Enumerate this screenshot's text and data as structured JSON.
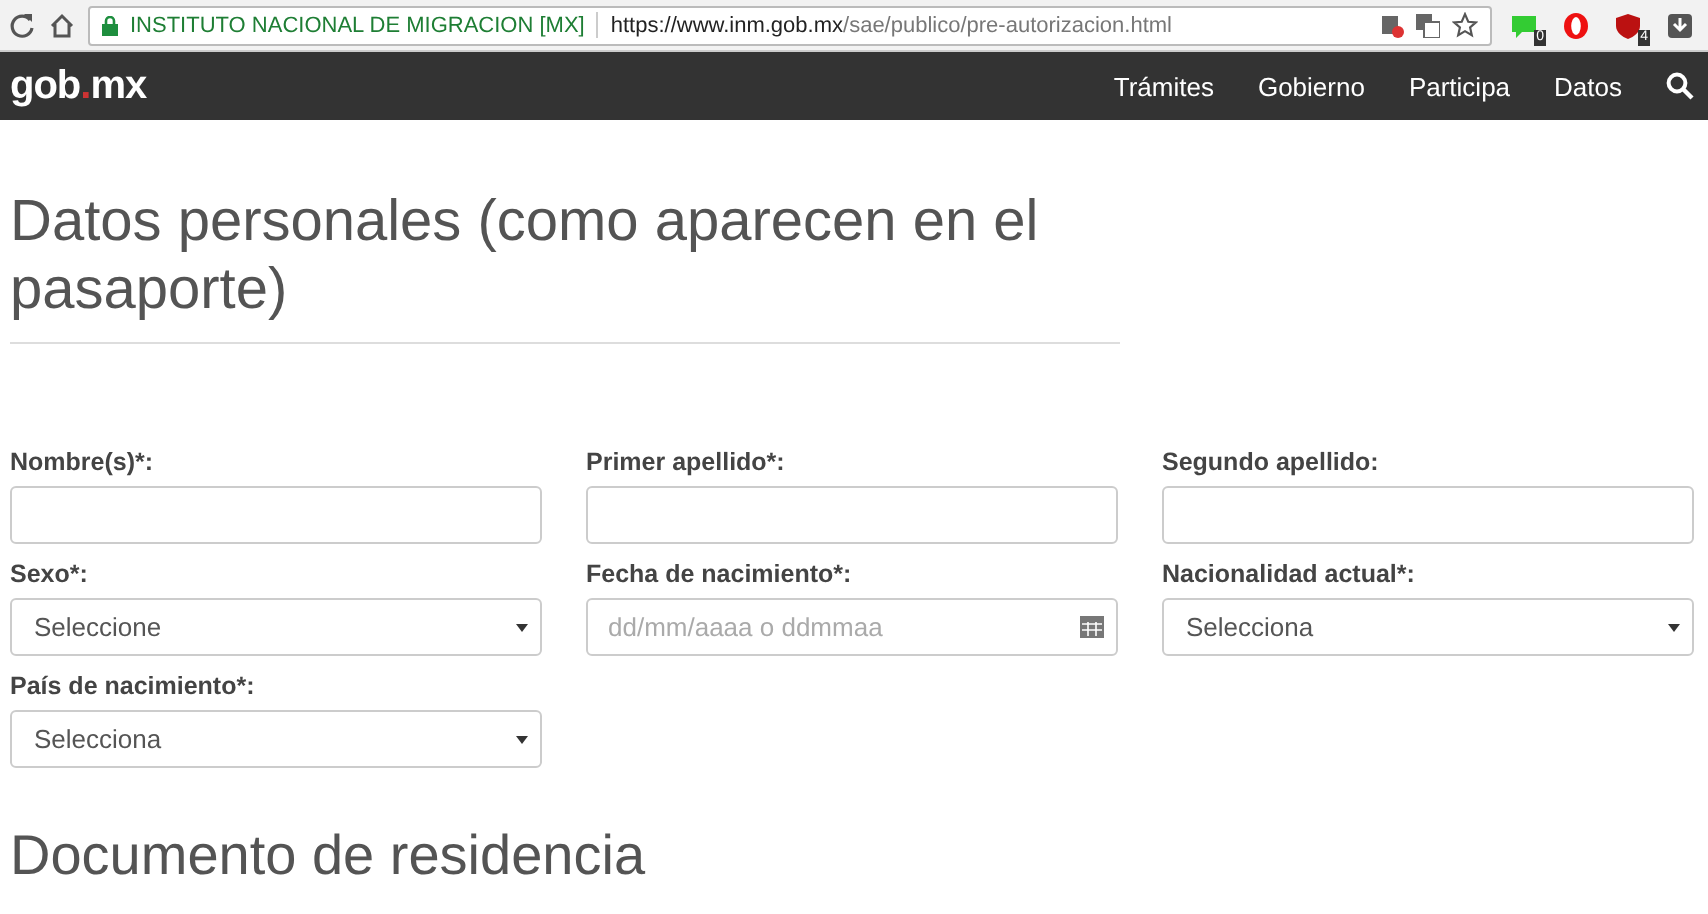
{
  "browser": {
    "site_name": "INSTITUTO NACIONAL DE MIGRACION [MX]",
    "url_host": "https://www.inm.gob.mx",
    "url_path": "/sae/publico/pre-autorizacion.html",
    "extensions": [
      {
        "kind": "chat",
        "badge": "0"
      },
      {
        "kind": "opera"
      },
      {
        "kind": "shield",
        "badge": "4"
      },
      {
        "kind": "download"
      }
    ]
  },
  "navbar": {
    "logo_left": "gob",
    "logo_dot": ".",
    "logo_right": "mx",
    "links": [
      "Trámites",
      "Gobierno",
      "Participa",
      "Datos"
    ]
  },
  "section_title": "Datos personales (como aparecen en el pasaporte)",
  "fields": [
    {
      "label": "Nombre(s)*:",
      "kind": "text"
    },
    {
      "label": "Primer apellido*:",
      "kind": "text"
    },
    {
      "label": "Segundo apellido:",
      "kind": "text"
    },
    {
      "label": "Sexo*:",
      "kind": "select",
      "value": "Seleccione"
    },
    {
      "label": "Fecha de nacimiento*:",
      "kind": "date",
      "placeholder": "dd/mm/aaaa o ddmmaa"
    },
    {
      "label": "Nacionalidad actual*:",
      "kind": "select",
      "value": "Selecciona"
    },
    {
      "label": "País de nacimiento*:",
      "kind": "select",
      "value": "Selecciona"
    }
  ],
  "next_section_title": "Documento de residencia"
}
